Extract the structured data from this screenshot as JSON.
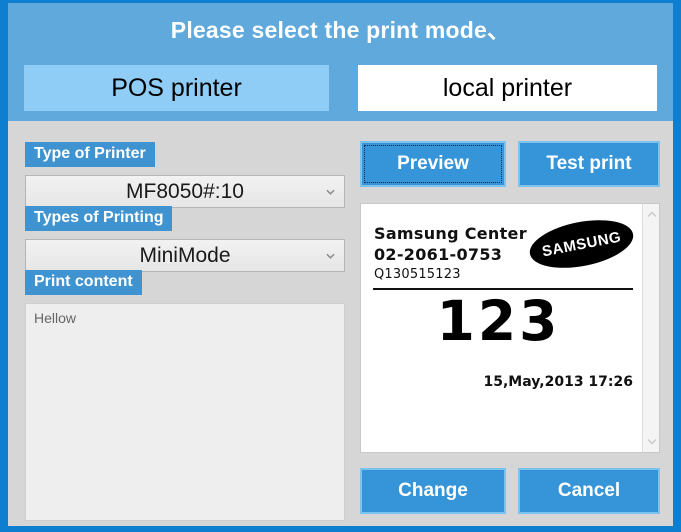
{
  "dialog": {
    "title": "Please select the print mode、",
    "border_color": "#0e7ed0",
    "header_bg": "#5fa9dd",
    "panel_bg": "#d6d6d6",
    "accent": "#3694d8",
    "label_badge": "#3f93d0"
  },
  "mode_tabs": [
    {
      "label": "POS printer",
      "selected": true,
      "bg": "#8fcdf7"
    },
    {
      "label": "local printer",
      "selected": false,
      "bg": "#ffffff"
    }
  ],
  "left_panel": {
    "printer_type": {
      "label": "Type of Printer",
      "value": "MF8050#:10",
      "icon": "chevron-down-icon"
    },
    "printing_type": {
      "label": "Types of Printing",
      "value": "MiniMode",
      "icon": "chevron-down-icon"
    },
    "print_content": {
      "label": "Print content",
      "value": "Hellow",
      "placeholder": ""
    }
  },
  "right_panel": {
    "buttons": {
      "preview": "Preview",
      "test_print": "Test print",
      "change": "Change",
      "cancel": "Cancel"
    },
    "preview": {
      "store_name": "Samsung Center",
      "phone": "02-2061-0753",
      "code": "Q130515123",
      "number": "123",
      "datetime": "15,May,2013  17:26",
      "logo_text": "SAMSUNG",
      "scrollbar": {
        "up_icon": "chevron-up-icon",
        "down_icon": "chevron-down-icon"
      }
    }
  }
}
